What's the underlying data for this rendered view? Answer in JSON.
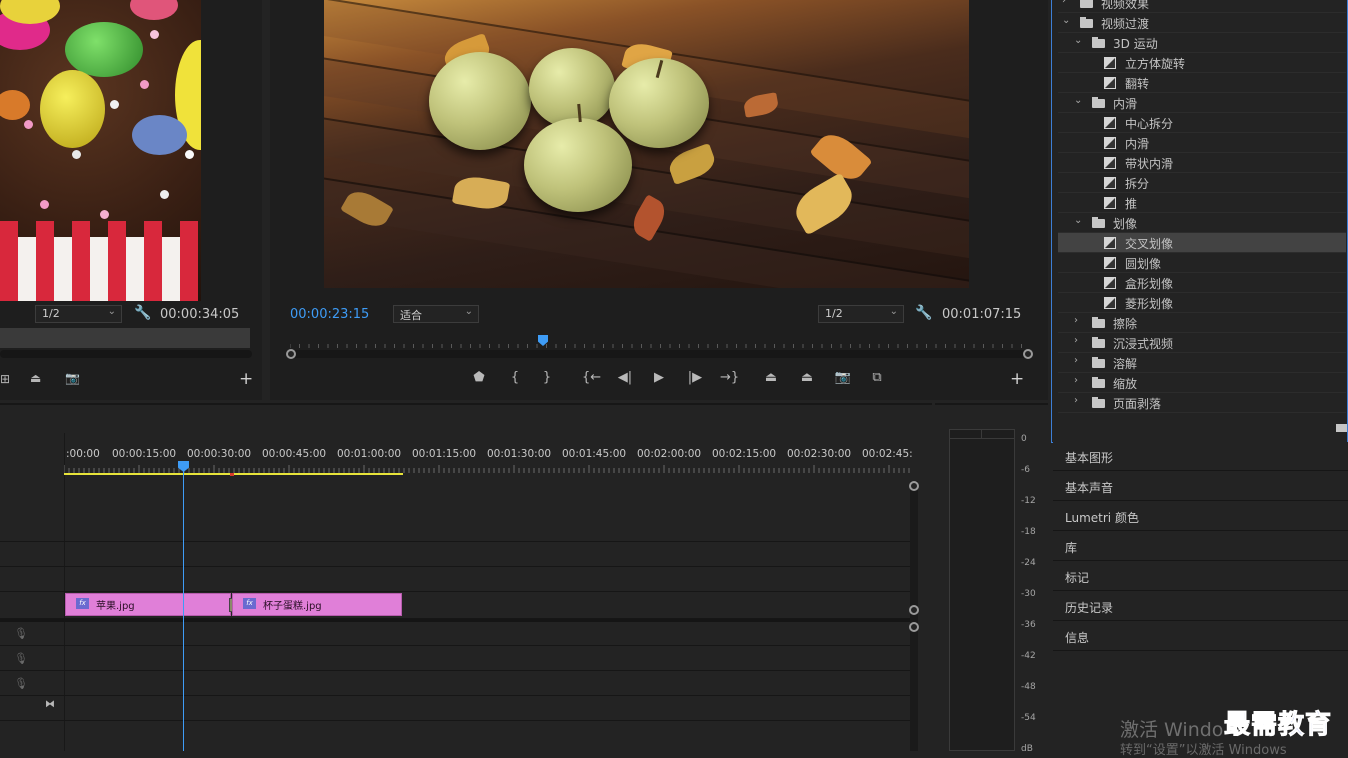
{
  "source_monitor": {
    "scale_value": "1/2",
    "duration": "00:00:34:05"
  },
  "program_monitor": {
    "current_time": "00:00:23:15",
    "fit_value": "适合",
    "scale_value": "1/2",
    "duration": "00:01:07:15",
    "controls": [
      {
        "name": "add-marker-icon",
        "glyph": "⬟"
      },
      {
        "name": "mark-in-icon",
        "glyph": "{"
      },
      {
        "name": "mark-out-icon",
        "glyph": "}"
      },
      {
        "name": "go-to-in-icon",
        "glyph": "{←"
      },
      {
        "name": "step-back-icon",
        "glyph": "◀|"
      },
      {
        "name": "play-icon",
        "glyph": "▶"
      },
      {
        "name": "step-forward-icon",
        "glyph": "|▶"
      },
      {
        "name": "go-to-out-icon",
        "glyph": "→}"
      },
      {
        "name": "lift-icon",
        "glyph": "⏏"
      },
      {
        "name": "extract-icon",
        "glyph": "⏏"
      },
      {
        "name": "export-frame-icon",
        "glyph": "📷"
      },
      {
        "name": "compare-view-icon",
        "glyph": "⧉"
      }
    ]
  },
  "timeline": {
    "ruler": [
      ":00:00",
      "00:00:15:00",
      "00:00:30:00",
      "00:00:45:00",
      "00:01:00:00",
      "00:01:15:00",
      "00:01:30:00",
      "00:01:45:00",
      "00:02:00:00",
      "00:02:15:00",
      "00:02:30:00",
      "00:02:45:"
    ],
    "clips": [
      {
        "label": "苹果.jpg",
        "fx": "fx"
      },
      {
        "label": "杯子蛋糕.jpg",
        "fx": "fx"
      }
    ]
  },
  "audio_meter": {
    "scale": [
      "0",
      "-6",
      "-12",
      "-18",
      "-24",
      "-30",
      "-36",
      "-42",
      "-48",
      "-54",
      "dB"
    ]
  },
  "effects_tree": [
    {
      "label": "视频效果",
      "type": "folder",
      "level": 0,
      "open": false
    },
    {
      "label": "视频过渡",
      "type": "folder",
      "level": 0,
      "open": true
    },
    {
      "label": "3D 运动",
      "type": "folder",
      "level": 1,
      "open": true
    },
    {
      "label": "立方体旋转",
      "type": "effect",
      "level": 2
    },
    {
      "label": "翻转",
      "type": "effect",
      "level": 2
    },
    {
      "label": "内滑",
      "type": "folder",
      "level": 1,
      "open": true
    },
    {
      "label": "中心拆分",
      "type": "effect",
      "level": 2
    },
    {
      "label": "内滑",
      "type": "effect",
      "level": 2
    },
    {
      "label": "带状内滑",
      "type": "effect",
      "level": 2
    },
    {
      "label": "拆分",
      "type": "effect",
      "level": 2
    },
    {
      "label": "推",
      "type": "effect",
      "level": 2
    },
    {
      "label": "划像",
      "type": "folder",
      "level": 1,
      "open": true
    },
    {
      "label": "交叉划像",
      "type": "effect",
      "level": 2,
      "selected": true
    },
    {
      "label": "圆划像",
      "type": "effect",
      "level": 2
    },
    {
      "label": "盒形划像",
      "type": "effect",
      "level": 2
    },
    {
      "label": "菱形划像",
      "type": "effect",
      "level": 2
    },
    {
      "label": "擦除",
      "type": "folder",
      "level": 1,
      "open": false
    },
    {
      "label": "沉浸式视频",
      "type": "folder",
      "level": 1,
      "open": false
    },
    {
      "label": "溶解",
      "type": "folder",
      "level": 1,
      "open": false
    },
    {
      "label": "缩放",
      "type": "folder",
      "level": 1,
      "open": false
    },
    {
      "label": "页面剥落",
      "type": "folder",
      "level": 1,
      "open": false
    }
  ],
  "panels": [
    "基本图形",
    "基本声音",
    "Lumetri 颜色",
    "库",
    "标记",
    "历史记录",
    "信息"
  ],
  "watermark": {
    "activate_title": "激活 Windo",
    "activate_hint": "转到“设置”以激活 Windows",
    "brand": "最需教育"
  },
  "colors": {
    "accent_blue": "#3e9cf6",
    "clip_pink": "#e07fd8",
    "work_area_yellow": "#e8e43a",
    "panel_border": "#3d7fd6"
  }
}
